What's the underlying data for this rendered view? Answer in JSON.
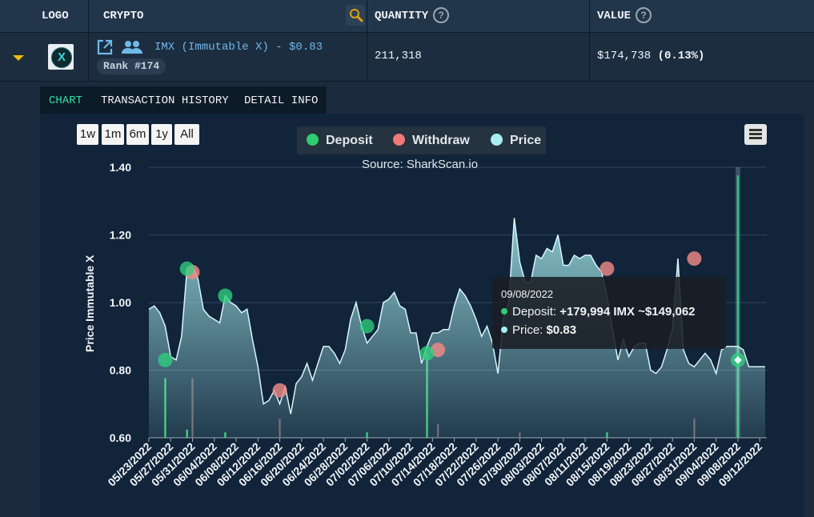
{
  "table": {
    "headers": {
      "logo": "LOGO",
      "crypto": "CRYPTO",
      "quantity": "QUANTITY",
      "value": "VALUE"
    },
    "help_glyph": "?",
    "row": {
      "coin_label": "IMX (Immutable X) - $0.83",
      "coin_glyph": "X",
      "rank": "Rank #174",
      "quantity": "211,318",
      "value": "$174,738",
      "value_pct": "(0.13%)"
    }
  },
  "tabs": [
    "CHART",
    "TRANSACTION HISTORY",
    "DETAIL INFO"
  ],
  "active_tab": "CHART",
  "range_buttons": [
    "1w",
    "1m",
    "6m",
    "1y",
    "All"
  ],
  "chart_data": {
    "type": "line",
    "source": "Source: SharkScan.io",
    "ylabel": "Price Immutable X",
    "ylim": [
      0.6,
      1.4
    ],
    "yticks": [
      "0.60",
      "0.80",
      "1.00",
      "1.20",
      "1.40"
    ],
    "xtick_labels": [
      "05/23/2022",
      "05/27/2022",
      "05/31/2022",
      "06/04/2022",
      "06/08/2022",
      "06/12/2022",
      "06/16/2022",
      "06/20/2022",
      "06/24/2022",
      "06/28/2022",
      "07/02/2022",
      "07/06/2022",
      "07/10/2022",
      "07/14/2022",
      "07/18/2022",
      "07/22/2022",
      "07/26/2022",
      "07/30/2022",
      "08/03/2022",
      "08/07/2022",
      "08/11/2022",
      "08/15/2022",
      "08/19/2022",
      "08/23/2022",
      "08/27/2022",
      "08/31/2022",
      "09/04/2022",
      "09/08/2022",
      "09/12/2022"
    ],
    "legend": [
      {
        "name": "Deposit",
        "color": "#2ecc71"
      },
      {
        "name": "Withdraw",
        "color": "#f07878"
      },
      {
        "name": "Price",
        "color": "#a9eef2"
      }
    ],
    "price_series": {
      "name": "Price",
      "x": [
        "05/23/2022",
        "05/24/2022",
        "05/25/2022",
        "05/26/2022",
        "05/27/2022",
        "05/28/2022",
        "05/29/2022",
        "05/30/2022",
        "05/31/2022",
        "06/01/2022",
        "06/02/2022",
        "06/03/2022",
        "06/04/2022",
        "06/05/2022",
        "06/06/2022",
        "06/07/2022",
        "06/08/2022",
        "06/09/2022",
        "06/10/2022",
        "06/11/2022",
        "06/12/2022",
        "06/13/2022",
        "06/14/2022",
        "06/15/2022",
        "06/16/2022",
        "06/17/2022",
        "06/18/2022",
        "06/19/2022",
        "06/20/2022",
        "06/21/2022",
        "06/22/2022",
        "06/23/2022",
        "06/24/2022",
        "06/25/2022",
        "06/26/2022",
        "06/27/2022",
        "06/28/2022",
        "06/29/2022",
        "06/30/2022",
        "07/01/2022",
        "07/02/2022",
        "07/03/2022",
        "07/04/2022",
        "07/05/2022",
        "07/06/2022",
        "07/07/2022",
        "07/08/2022",
        "07/09/2022",
        "07/10/2022",
        "07/11/2022",
        "07/12/2022",
        "07/13/2022",
        "07/14/2022",
        "07/15/2022",
        "07/16/2022",
        "07/17/2022",
        "07/18/2022",
        "07/19/2022",
        "07/20/2022",
        "07/21/2022",
        "07/22/2022",
        "07/23/2022",
        "07/24/2022",
        "07/25/2022",
        "07/26/2022",
        "07/27/2022",
        "07/28/2022",
        "07/29/2022",
        "07/30/2022",
        "07/31/2022",
        "08/01/2022",
        "08/02/2022",
        "08/03/2022",
        "08/04/2022",
        "08/05/2022",
        "08/06/2022",
        "08/07/2022",
        "08/08/2022",
        "08/09/2022",
        "08/10/2022",
        "08/11/2022",
        "08/12/2022",
        "08/13/2022",
        "08/14/2022",
        "08/15/2022",
        "08/16/2022",
        "08/17/2022",
        "08/18/2022",
        "08/19/2022",
        "08/20/2022",
        "08/21/2022",
        "08/22/2022",
        "08/23/2022",
        "08/24/2022",
        "08/25/2022",
        "08/26/2022",
        "08/27/2022",
        "08/28/2022",
        "08/29/2022",
        "08/30/2022",
        "08/31/2022",
        "09/01/2022",
        "09/02/2022",
        "09/03/2022",
        "09/04/2022",
        "09/05/2022",
        "09/06/2022",
        "09/07/2022",
        "09/08/2022",
        "09/09/2022",
        "09/10/2022",
        "09/11/2022",
        "09/12/2022",
        "09/13/2022"
      ],
      "y": [
        0.98,
        0.99,
        0.97,
        0.93,
        0.84,
        0.83,
        0.9,
        1.1,
        1.11,
        1.07,
        0.98,
        0.96,
        0.95,
        0.94,
        1.02,
        1.0,
        0.99,
        0.97,
        0.98,
        0.89,
        0.81,
        0.7,
        0.71,
        0.74,
        0.7,
        0.75,
        0.67,
        0.76,
        0.78,
        0.82,
        0.77,
        0.82,
        0.87,
        0.87,
        0.85,
        0.82,
        0.86,
        0.95,
        1.0,
        0.93,
        0.88,
        0.9,
        0.92,
        1.0,
        1.01,
        1.03,
        0.99,
        0.98,
        0.91,
        0.91,
        0.82,
        0.87,
        0.91,
        0.91,
        0.92,
        0.92,
        0.99,
        1.04,
        1.02,
        0.99,
        0.95,
        0.9,
        0.93,
        0.88,
        0.79,
        0.95,
        1.0,
        1.25,
        1.12,
        1.06,
        1.06,
        1.14,
        1.13,
        1.16,
        1.15,
        1.2,
        1.11,
        1.11,
        1.14,
        1.13,
        1.14,
        1.14,
        1.11,
        1.09,
        1.02,
        0.92,
        0.83,
        0.89,
        0.84,
        0.87,
        0.88,
        0.88,
        0.8,
        0.79,
        0.81,
        0.86,
        0.92,
        1.13,
        0.86,
        0.82,
        0.81,
        0.83,
        0.85,
        0.83,
        0.79,
        0.86,
        0.87,
        0.87,
        0.87,
        0.86,
        0.81,
        0.81,
        0.81,
        0.81
      ]
    },
    "deposit_points": [
      {
        "x": "05/26/2022",
        "y": 0.83
      },
      {
        "x": "05/30/2022",
        "y": 1.1
      },
      {
        "x": "06/06/2022",
        "y": 1.02
      },
      {
        "x": "07/02/2022",
        "y": 0.93
      },
      {
        "x": "07/13/2022",
        "y": 0.85
      },
      {
        "x": "09/08/2022",
        "y": 0.83
      }
    ],
    "withdraw_points": [
      {
        "x": "05/31/2022",
        "y": 1.09
      },
      {
        "x": "06/16/2022",
        "y": 0.74
      },
      {
        "x": "07/15/2022",
        "y": 0.86
      },
      {
        "x": "08/15/2022",
        "y": 1.1
      },
      {
        "x": "08/31/2022",
        "y": 1.13
      }
    ],
    "volume_bars": [
      {
        "x": "05/26/2022",
        "type": "deposit",
        "amount": 0.22
      },
      {
        "x": "05/30/2022",
        "type": "deposit",
        "amount": 0.03
      },
      {
        "x": "05/31/2022",
        "type": "withdraw",
        "amount": 0.22
      },
      {
        "x": "06/06/2022",
        "type": "deposit",
        "amount": 0.02
      },
      {
        "x": "06/16/2022",
        "type": "withdraw",
        "amount": 0.07
      },
      {
        "x": "07/02/2022",
        "type": "deposit",
        "amount": 0.02
      },
      {
        "x": "07/13/2022",
        "type": "deposit",
        "amount": 0.31
      },
      {
        "x": "07/15/2022",
        "type": "withdraw",
        "amount": 0.05
      },
      {
        "x": "07/30/2022",
        "type": "withdraw",
        "amount": 0.02
      },
      {
        "x": "08/15/2022",
        "type": "deposit",
        "amount": 0.02
      },
      {
        "x": "08/31/2022",
        "type": "withdraw",
        "amount": 0.07
      },
      {
        "x": "09/08/2022",
        "type": "deposit",
        "amount": 0.97
      }
    ],
    "tooltip": {
      "date": "09/08/2022",
      "deposit_label": "Deposit: ",
      "deposit_value": "+179,994 IMX ~$149,062",
      "price_label": "Price: ",
      "price_value": "$0.83"
    }
  }
}
